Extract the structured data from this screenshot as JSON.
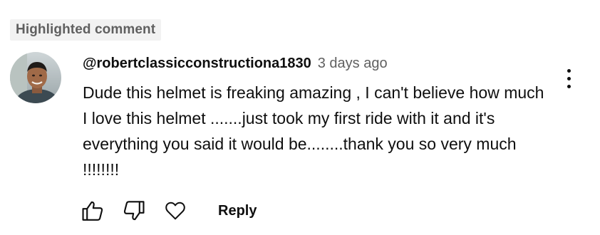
{
  "badge": {
    "label": "Highlighted comment"
  },
  "comment": {
    "author": "@robertclassicconstructiona1830",
    "time": "3 days ago",
    "text": "Dude this helmet is freaking amazing , I can't believe how much I love this helmet .......just took my first ride with it and it's everything you said it would be........thank you so very much !!!!!!!!"
  },
  "actions": {
    "like_icon": "thumbs-up-icon",
    "dislike_icon": "thumbs-down-icon",
    "heart_icon": "heart-icon",
    "reply_label": "Reply"
  },
  "menu": {
    "icon": "more-vert-icon"
  },
  "colors": {
    "text": "#0f0f0f",
    "secondary": "#606060",
    "badge_bg": "#f2f2f2"
  }
}
